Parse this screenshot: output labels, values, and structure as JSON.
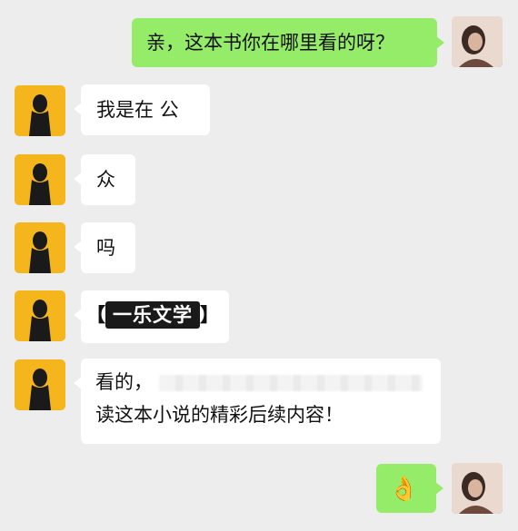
{
  "messages": [
    {
      "side": "right",
      "text": "亲，这本书你在哪里看的呀？"
    },
    {
      "side": "left",
      "text": "我是在 公"
    },
    {
      "side": "left",
      "text": "众"
    },
    {
      "side": "left",
      "text": "吗"
    },
    {
      "side": "left",
      "bracket_open": "【",
      "brand": "一乐文学",
      "bracket_close": "】"
    },
    {
      "side": "left",
      "line1": "看的，",
      "line2": "读这本小说的精彩后续内容！"
    },
    {
      "side": "right",
      "emoji": "👌"
    }
  ],
  "colors": {
    "background": "#ededed",
    "green_bubble": "#95ec69",
    "white_bubble": "#ffffff",
    "other_avatar": "#f5b51c"
  },
  "icons": {
    "other_avatar": "silhouette-avatar-icon",
    "self_avatar": "photo-avatar",
    "ok_emoji": "ok-hand-icon"
  }
}
